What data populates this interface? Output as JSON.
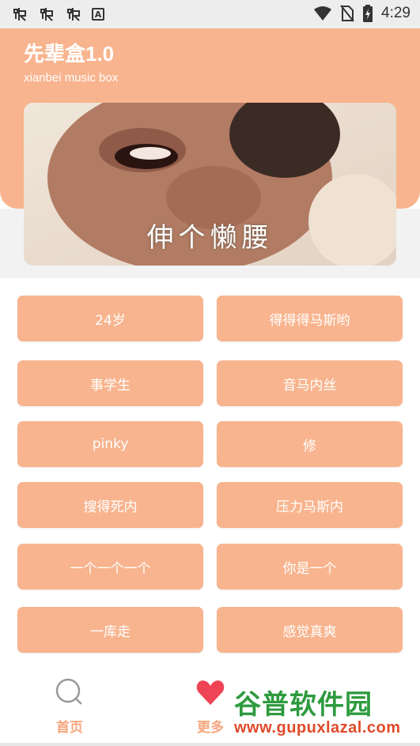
{
  "status_bar": {
    "time": "4:29",
    "left_icons": [
      "bug-icon",
      "bug-icon",
      "bug-icon",
      "a-box-icon"
    ],
    "right_icons": [
      "wifi-icon",
      "no-sim-icon",
      "battery-charging-icon"
    ]
  },
  "header": {
    "title": "先辈盒1.0",
    "subtitle": "xianbei music box",
    "background_color": "#f8b48e"
  },
  "banner": {
    "caption": "伸个懒腰"
  },
  "sound_buttons": [
    "24岁",
    "得得得马斯哟",
    "事学生",
    "音马内丝",
    "pinky",
    "修",
    "搜得死内",
    "压力马斯内",
    "一个一个一个",
    "你是一个",
    "一库走",
    "感觉真爽"
  ],
  "tab_bar": {
    "home_label": "首页",
    "more_label": "更多",
    "accent_color": "#f6a57c",
    "home_icon": "search-circle-icon",
    "more_icon": "heart-icon"
  },
  "watermark": {
    "name": "谷普软件园",
    "url": "www.gupuxlazal.com"
  }
}
